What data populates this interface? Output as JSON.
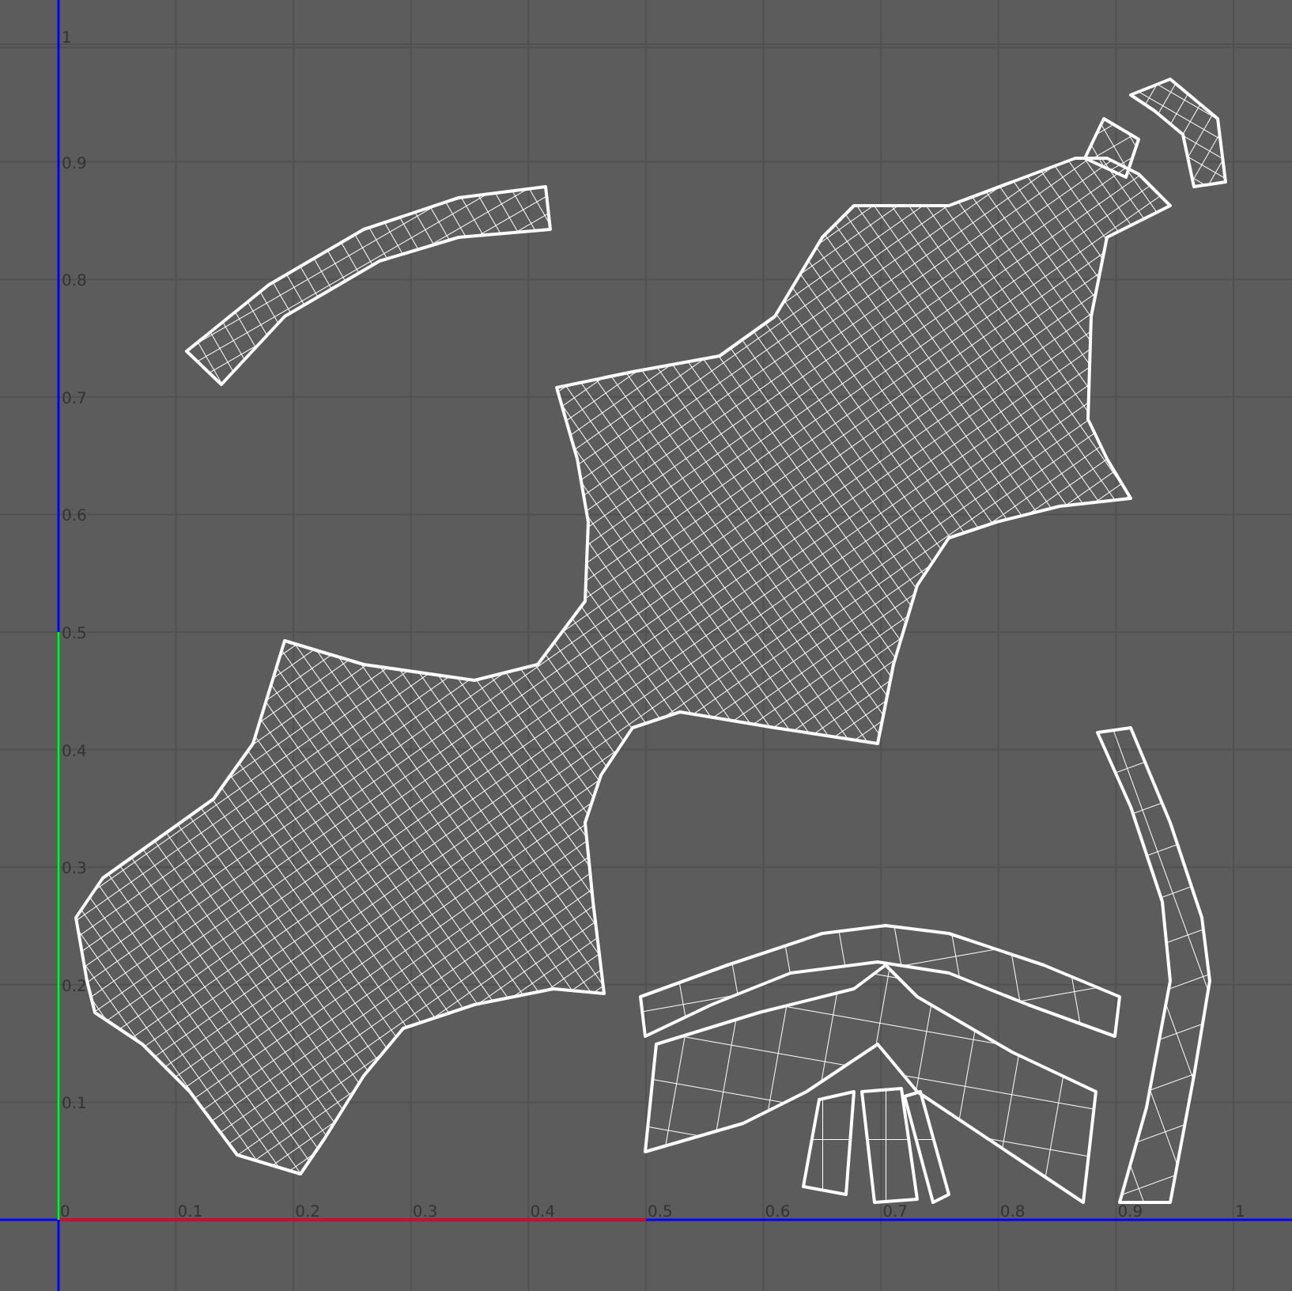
{
  "uv_grid": {
    "x_ticks": [
      "0",
      "0.1",
      "0.2",
      "0.3",
      "0.4",
      "0.5",
      "0.6",
      "0.7",
      "0.8",
      "0.9",
      "1"
    ],
    "y_ticks": [
      "1",
      "0.9",
      "0.8",
      "0.7",
      "0.6",
      "0.5",
      "0.4",
      "0.3",
      "0.2",
      "0.1"
    ]
  }
}
